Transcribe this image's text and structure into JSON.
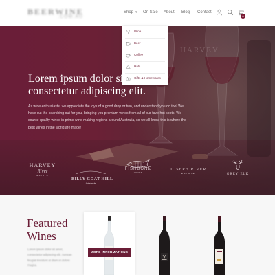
{
  "header": {
    "logo": {
      "main": "BEERWINE",
      "sub": ".COM.AU"
    },
    "nav": {
      "shop": "Shop",
      "on_sale": "On Sale",
      "about": "About",
      "blog": "Blog",
      "contact": "Contact"
    },
    "icons": [
      "user-icon",
      "search-icon",
      "cart-icon"
    ],
    "cart_count": "0"
  },
  "shop_menu": {
    "items": [
      {
        "label": "Wine",
        "icon": "wine-glass-icon"
      },
      {
        "label": "Beer",
        "icon": "beer-icon"
      },
      {
        "label": "Coffee",
        "icon": "coffee-icon"
      },
      {
        "label": "Hats",
        "icon": "hat-icon"
      },
      {
        "label": "Gifts & Homewares",
        "icon": "gift-icon"
      }
    ]
  },
  "hero": {
    "title": "Lorem ipsum dolor sit amet, consectetur adipiscing elit.",
    "text": "As wine enthusiasts, we appreciate the joys of a good drop or two, and understand you do too! We have cut the searching out for you, bringing you premium wines from all of our fave hot spots. We source quality wines in prime wine making regions around Australia, so we all know this is where the best wines in the world are made!",
    "brands": {
      "harvey": {
        "line1": "HARVEY",
        "line2": "River",
        "line3": "ESTATE"
      },
      "billy": {
        "line1": "BILLY GOAT HILL",
        "line2": "Adelaide"
      },
      "fishbone": {
        "line1": "FISHBONE",
        "line2": "WINES"
      },
      "joseph": {
        "line1": "JOSEPH RIVER",
        "line2": "ESTATE"
      },
      "grey_elk": {
        "line1": "GREY ELK"
      }
    }
  },
  "featured": {
    "title": "Featured Wines",
    "text": "Lorem ipsum dolor sit amet, consectetur adipiscing elit. Aenean feugiat tincidunt ut diam et dolore magna.",
    "more_button": "MORE INFORMATIONS"
  },
  "colors": {
    "accent": "#6a1d36",
    "hero_base": "#6a1e38",
    "section_bg": "#f7f7f7"
  }
}
